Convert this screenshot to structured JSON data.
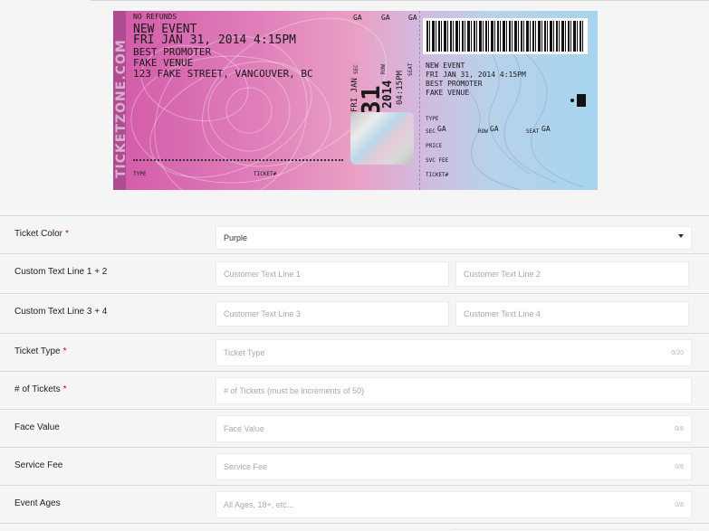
{
  "ticket": {
    "brand_vertical": "TICKETZONE.COM",
    "no_refunds": "NO REFUNDS",
    "event_name": "NEW EVENT",
    "event_datetime": "FRI JAN 31, 2014 4:15PM",
    "promoter": "BEST PROMOTER",
    "venue": "FAKE VENUE",
    "address": "123 FAKE STREET, VANCOUVER, BC",
    "type_label": "TYPE",
    "ticket_label": "TICKET#",
    "ga_top": [
      "GA",
      "GA",
      "GA"
    ],
    "center_sec": "SEC",
    "center_row": "ROW",
    "center_seat": "SEAT",
    "center_day": "FRI JAN",
    "center_date_num": "31",
    "center_year": "2014",
    "center_time": "04:15PM",
    "stub": {
      "event_name": "NEW EVENT",
      "event_datetime": "FRI JAN 31, 2014 4:15PM",
      "promoter": "BEST PROMOTER",
      "venue": "FAKE VENUE",
      "type_label": "TYPE",
      "sec_label": "SEC",
      "sec_value": "GA",
      "row_label": "ROW",
      "row_value": "GA",
      "seat_label": "SEAT",
      "seat_value": "GA",
      "price_label": "PRICE",
      "svc_fee_label": "SVC FEE",
      "ticket_label": "TICKET#"
    }
  },
  "form": {
    "required_mark": "*",
    "ticket_color": {
      "label": "Ticket Color",
      "value": "Purple"
    },
    "custom_12": {
      "label": "Custom Text Line 1 + 2",
      "ph1": "Customer Text Line 1",
      "ph2": "Customer Text Line 2"
    },
    "custom_34": {
      "label": "Custom Text Line 3 + 4",
      "ph1": "Customer Text Line 3",
      "ph2": "Customer Text Line 4"
    },
    "ticket_type": {
      "label": "Ticket Type",
      "placeholder": "Ticket Type",
      "counter": "0/20"
    },
    "num_tickets": {
      "label": "# of Tickets",
      "placeholder": "# of Tickets (must be increments of 50)"
    },
    "face_value": {
      "label": "Face Value",
      "placeholder": "Face Value",
      "counter": "0/8"
    },
    "service_fee": {
      "label": "Service Fee",
      "placeholder": "Service Fee",
      "counter": "0/8"
    },
    "event_ages": {
      "label": "Event Ages",
      "placeholder": "All Ages, 18+, etc...",
      "counter": "0/8"
    }
  }
}
